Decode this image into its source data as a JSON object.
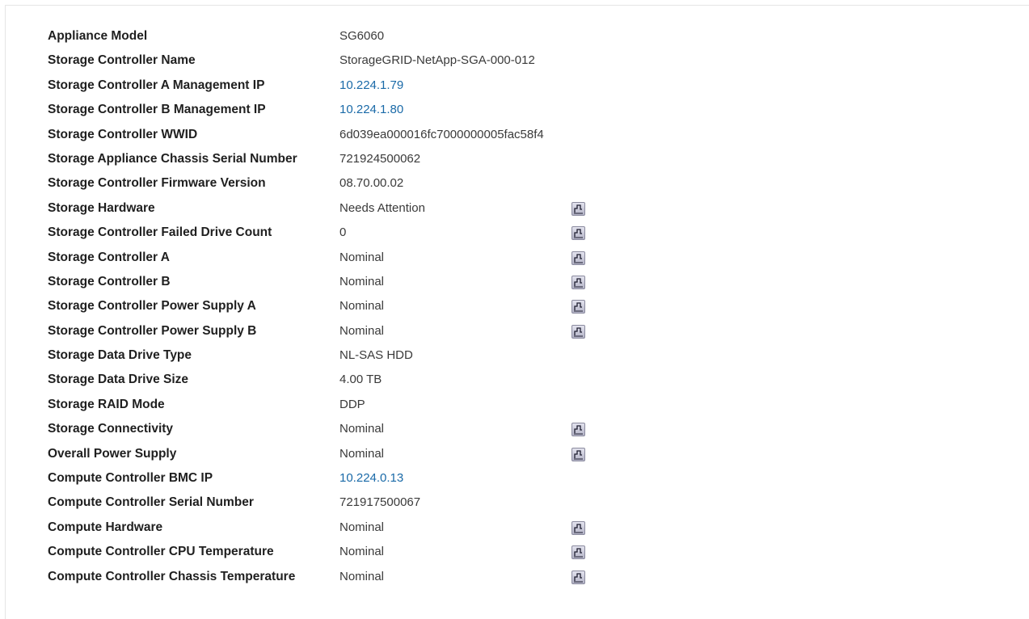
{
  "icons": {
    "chart": "chart-icon"
  },
  "colors": {
    "link": "#1a6aa8",
    "label": "#1f1f1f",
    "value": "#3a3a3a",
    "icon_fill": "#b3b3c6"
  },
  "rows": [
    {
      "label": "Appliance Model",
      "value": "SG6060"
    },
    {
      "label": "Storage Controller Name",
      "value": "StorageGRID-NetApp-SGA-000-012"
    },
    {
      "label": "Storage Controller A Management IP",
      "value": "10.224.1.79"
    },
    {
      "label": "Storage Controller B Management IP",
      "value": "10.224.1.80"
    },
    {
      "label": "Storage Controller WWID",
      "value": "6d039ea000016fc7000000005fac58f4"
    },
    {
      "label": "Storage Appliance Chassis Serial Number",
      "value": "721924500062"
    },
    {
      "label": "Storage Controller Firmware Version",
      "value": "08.70.00.02"
    },
    {
      "label": "Storage Hardware",
      "value": "Needs Attention"
    },
    {
      "label": "Storage Controller Failed Drive Count",
      "value": "0"
    },
    {
      "label": "Storage Controller A",
      "value": "Nominal"
    },
    {
      "label": "Storage Controller B",
      "value": "Nominal"
    },
    {
      "label": "Storage Controller Power Supply A",
      "value": "Nominal"
    },
    {
      "label": "Storage Controller Power Supply B",
      "value": "Nominal"
    },
    {
      "label": "Storage Data Drive Type",
      "value": "NL-SAS HDD"
    },
    {
      "label": "Storage Data Drive Size",
      "value": "4.00 TB"
    },
    {
      "label": "Storage RAID Mode",
      "value": "DDP"
    },
    {
      "label": "Storage Connectivity",
      "value": "Nominal"
    },
    {
      "label": "Overall Power Supply",
      "value": "Nominal"
    },
    {
      "label": "Compute Controller BMC IP",
      "value": "10.224.0.13"
    },
    {
      "label": "Compute Controller Serial Number",
      "value": "721917500067"
    },
    {
      "label": "Compute Hardware",
      "value": "Nominal"
    },
    {
      "label": "Compute Controller CPU Temperature",
      "value": "Nominal"
    },
    {
      "label": "Compute Controller Chassis Temperature",
      "value": "Nominal"
    }
  ]
}
